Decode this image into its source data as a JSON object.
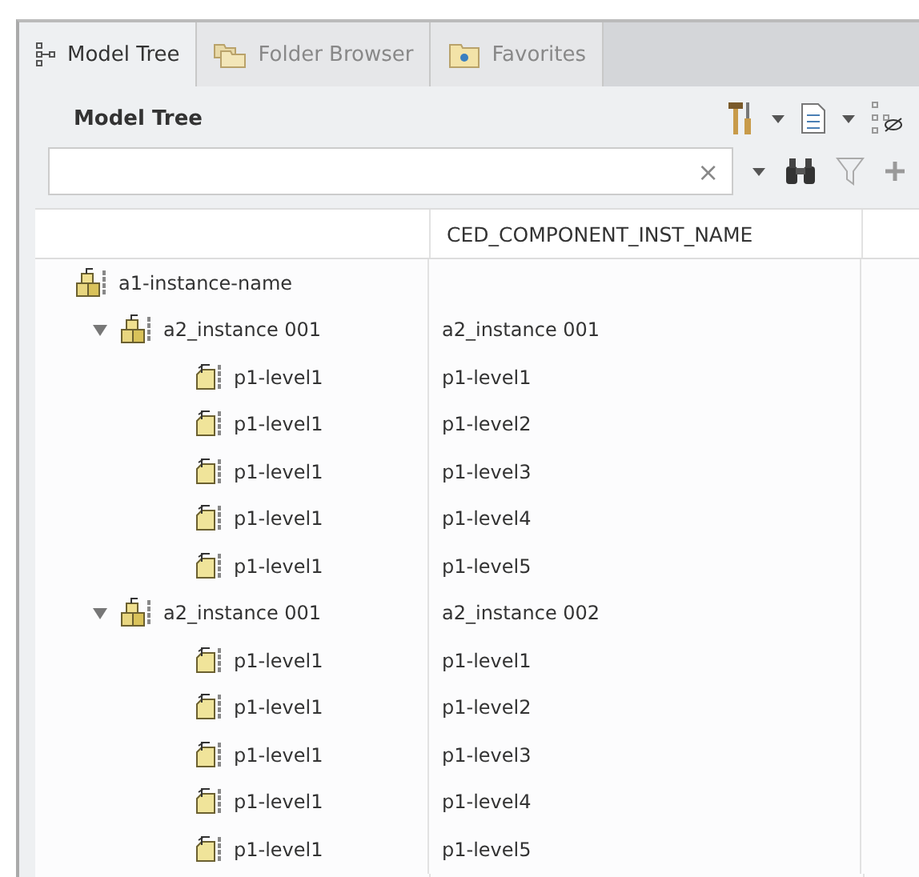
{
  "tabs": [
    {
      "label": "Model Tree",
      "kind": "tree",
      "selected": true
    },
    {
      "label": "Folder Browser",
      "kind": "folders",
      "selected": false
    },
    {
      "label": "Favorites",
      "kind": "favorites",
      "selected": false
    }
  ],
  "panel": {
    "title": "Model Tree",
    "search": {
      "clear": "×"
    }
  },
  "table": {
    "columns": [
      "CED_COMPONENT_INST_NAME"
    ],
    "tree": [
      {
        "name": "a1-instance-name",
        "kind": "assembly",
        "children": [
          {
            "name": "a2_instance 001",
            "kind": "assembly",
            "expanded": true,
            "value": "a2_instance 001",
            "children": [
              {
                "name": "p1-level1",
                "kind": "part",
                "value": "p1-level1"
              },
              {
                "name": "p1-level1",
                "kind": "part",
                "value": "p1-level2"
              },
              {
                "name": "p1-level1",
                "kind": "part",
                "value": "p1-level3"
              },
              {
                "name": "p1-level1",
                "kind": "part",
                "value": "p1-level4"
              },
              {
                "name": "p1-level1",
                "kind": "part",
                "value": "p1-level5"
              }
            ]
          },
          {
            "name": "a2_instance 001",
            "kind": "assembly",
            "expanded": true,
            "value": "a2_instance 002",
            "children": [
              {
                "name": "p1-level1",
                "kind": "part",
                "value": "p1-level1"
              },
              {
                "name": "p1-level1",
                "kind": "part",
                "value": "p1-level2"
              },
              {
                "name": "p1-level1",
                "kind": "part",
                "value": "p1-level3"
              },
              {
                "name": "p1-level1",
                "kind": "part",
                "value": "p1-level4"
              },
              {
                "name": "p1-level1",
                "kind": "part",
                "value": "p1-level5"
              }
            ]
          }
        ]
      }
    ]
  }
}
